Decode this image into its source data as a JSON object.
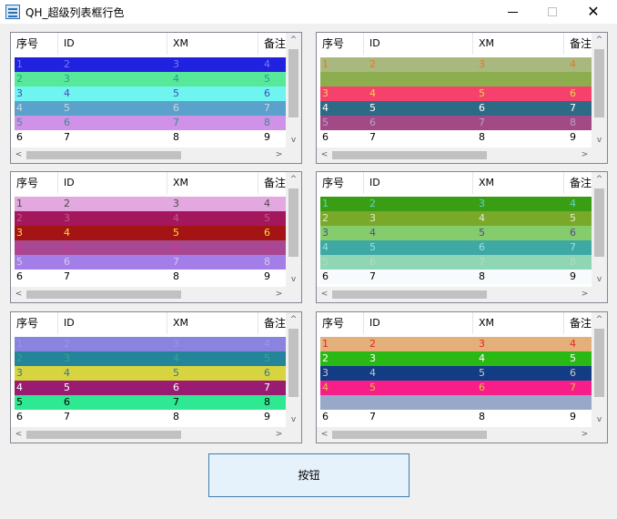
{
  "window": {
    "title": "QH_超级列表框行色",
    "icons": {
      "minimize": "minimize-icon",
      "maximize": "maximize-icon",
      "close": "close-icon"
    }
  },
  "columns": [
    "序号",
    "ID",
    "XM",
    "备注"
  ],
  "listviews": [
    {
      "rows": [
        {
          "cells": [
            "1",
            "2",
            "3",
            "4"
          ],
          "bg": "#2121e0",
          "fg": "#7a7af0"
        },
        {
          "cells": [
            "2",
            "3",
            "4",
            "5"
          ],
          "bg": "#58e89a",
          "fg": "#2e9a8f"
        },
        {
          "cells": [
            "3",
            "4",
            "5",
            "6"
          ],
          "bg": "#6ef5ef",
          "fg": "#4a4ab8"
        },
        {
          "cells": [
            "4",
            "5",
            "6",
            "7"
          ],
          "bg": "#5aa2cc",
          "fg": "#c9d6e0"
        },
        {
          "cells": [
            "5",
            "6",
            "7",
            "8"
          ],
          "bg": "#cf92e8",
          "fg": "#3b8e8c"
        },
        {
          "cells": [
            "6",
            "7",
            "8",
            "9"
          ],
          "bg": "#ffffff",
          "fg": "#000000"
        }
      ]
    },
    {
      "rows": [
        {
          "cells": [
            "1",
            "2",
            "3",
            "4"
          ],
          "bg": "#a9b87e",
          "fg": "#e27a2a"
        },
        {
          "cells": [
            "",
            "",
            "",
            ""
          ],
          "bg": "#8cae4e",
          "fg": "#8cae4e"
        },
        {
          "cells": [
            "3",
            "4",
            "5",
            "6"
          ],
          "bg": "#f5416c",
          "fg": "#e8d64a"
        },
        {
          "cells": [
            "4",
            "5",
            "6",
            "7"
          ],
          "bg": "#2d6a86",
          "fg": "#ffffff"
        },
        {
          "cells": [
            "5",
            "6",
            "7",
            "8"
          ],
          "bg": "#a14a86",
          "fg": "#b9a2c8"
        },
        {
          "cells": [
            "6",
            "7",
            "8",
            "9"
          ],
          "bg": "#ffffff",
          "fg": "#000000"
        }
      ]
    },
    {
      "rows": [
        {
          "cells": [
            "1",
            "2",
            "3",
            "4"
          ],
          "bg": "#e4a8e0",
          "fg": "#4a4a4a"
        },
        {
          "cells": [
            "2",
            "3",
            "4",
            "5"
          ],
          "bg": "#a4175c",
          "fg": "#c45a8a"
        },
        {
          "cells": [
            "3",
            "4",
            "5",
            "6"
          ],
          "bg": "#a41414",
          "fg": "#f5e030"
        },
        {
          "cells": [
            "4",
            "5",
            "6",
            "7"
          ],
          "bg": "#a84892",
          "fg": "#d0348a"
        },
        {
          "cells": [
            "5",
            "6",
            "7",
            "8"
          ],
          "bg": "#a47ee8",
          "fg": "#d8c7f0"
        },
        {
          "cells": [
            "6",
            "7",
            "8",
            "9"
          ],
          "bg": "#ffffff",
          "fg": "#000000"
        }
      ]
    },
    {
      "rows": [
        {
          "cells": [
            "1",
            "2",
            "3",
            "4"
          ],
          "bg": "#3a9e14",
          "fg": "#5bd6c8"
        },
        {
          "cells": [
            "2",
            "3",
            "4",
            "5"
          ],
          "bg": "#7aa828",
          "fg": "#e0ecc8"
        },
        {
          "cells": [
            "3",
            "4",
            "5",
            "6"
          ],
          "bg": "#84cc6c",
          "fg": "#5a4a8a"
        },
        {
          "cells": [
            "4",
            "5",
            "6",
            "7"
          ],
          "bg": "#3ea8a4",
          "fg": "#9ae0e0"
        },
        {
          "cells": [
            "5",
            "6",
            "7",
            "8"
          ],
          "bg": "#8ed6b4",
          "fg": "#b0dcc8"
        },
        {
          "cells": [
            "6",
            "7",
            "8",
            "9"
          ],
          "bg": "#f8fbfd",
          "fg": "#000000"
        }
      ]
    },
    {
      "rows": [
        {
          "cells": [
            "1",
            "2",
            "3",
            "4"
          ],
          "bg": "#8a84e0",
          "fg": "#9a94e8"
        },
        {
          "cells": [
            "2",
            "3",
            "4",
            "5"
          ],
          "bg": "#24849a",
          "fg": "#2eaa8a"
        },
        {
          "cells": [
            "3",
            "4",
            "5",
            "6"
          ],
          "bg": "#d8d440",
          "fg": "#2e7a9a"
        },
        {
          "cells": [
            "4",
            "5",
            "6",
            "7"
          ],
          "bg": "#9a1c72",
          "fg": "#ffffff"
        },
        {
          "cells": [
            "5",
            "6",
            "7",
            "8"
          ],
          "bg": "#2ee892",
          "fg": "#000000"
        },
        {
          "cells": [
            "6",
            "7",
            "8",
            "9"
          ],
          "bg": "#ffffff",
          "fg": "#000000"
        }
      ]
    },
    {
      "rows": [
        {
          "cells": [
            "1",
            "2",
            "3",
            "4"
          ],
          "bg": "#e4b07a",
          "fg": "#e02a2a"
        },
        {
          "cells": [
            "2",
            "3",
            "4",
            "5"
          ],
          "bg": "#2ab814",
          "fg": "#ffffff"
        },
        {
          "cells": [
            "3",
            "4",
            "5",
            "6"
          ],
          "bg": "#123c84",
          "fg": "#c8c8c8"
        },
        {
          "cells": [
            "4",
            "5",
            "6",
            "7"
          ],
          "bg": "#f81e8a",
          "fg": "#e0c040"
        },
        {
          "cells": [
            "",
            "",
            "",
            ""
          ],
          "bg": "#98a8c8",
          "fg": "#98a8c8"
        },
        {
          "cells": [
            "6",
            "7",
            "8",
            "9"
          ],
          "bg": "#ffffff",
          "fg": "#000000"
        }
      ]
    }
  ],
  "button": {
    "label": "按钮"
  }
}
